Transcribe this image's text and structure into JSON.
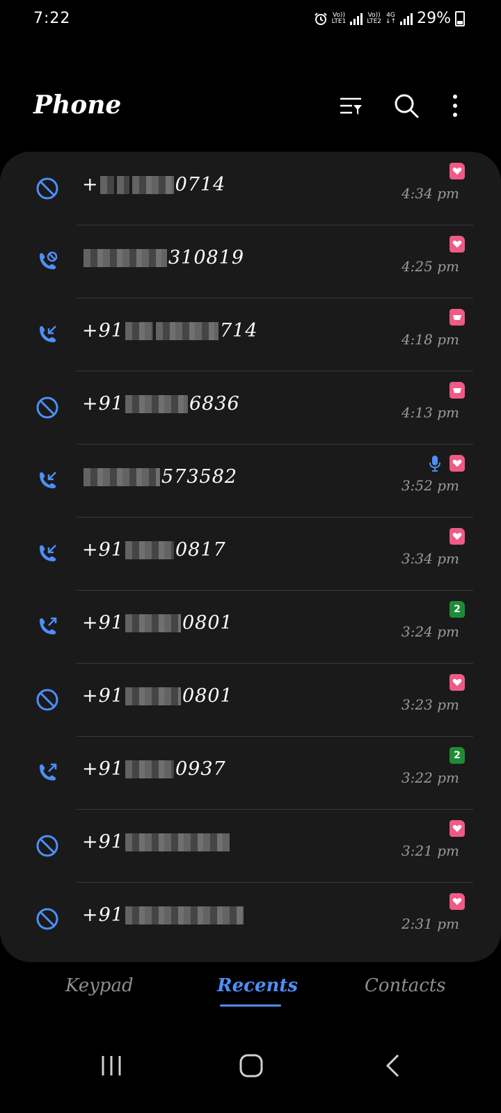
{
  "status_bar": {
    "time": "7:22",
    "sim1_label": "VoLTE1",
    "sim2_label": "VoLTE2",
    "network": "4G",
    "battery": "29%"
  },
  "header": {
    "title": "Phone",
    "icons": [
      "filter-icon",
      "search-icon",
      "more-options-icon"
    ]
  },
  "colors": {
    "accent": "#4d8ff7",
    "sim_pink": "#ef5a86",
    "sim_green": "#1e8c35",
    "card_bg": "#1a1a1b"
  },
  "calls": [
    {
      "type": "blocked",
      "number_prefix": "+",
      "number_suffix": "0714",
      "sim": "sim1-heart",
      "time": "4:34 pm",
      "mic": false
    },
    {
      "type": "missed-blocked",
      "number_prefix": "",
      "number_suffix": "310819",
      "sim": "sim1-heart",
      "time": "4:25 pm",
      "mic": false
    },
    {
      "type": "incoming",
      "number_prefix": "+91",
      "number_suffix": "714",
      "sim": "sim1-card",
      "time": "4:18 pm",
      "mic": false
    },
    {
      "type": "blocked",
      "number_prefix": "+91",
      "number_suffix": "6836",
      "sim": "sim1-card",
      "time": "4:13 pm",
      "mic": false
    },
    {
      "type": "incoming",
      "number_prefix": "",
      "number_suffix": "573582",
      "sim": "sim1-heart",
      "time": "3:52 pm",
      "mic": true
    },
    {
      "type": "incoming",
      "number_prefix": "+91",
      "number_suffix": "0817",
      "sim": "sim1-heart",
      "time": "3:34 pm",
      "mic": false
    },
    {
      "type": "outgoing",
      "number_prefix": "+91",
      "number_suffix": "0801",
      "sim": "sim2",
      "sim_label": "2",
      "time": "3:24 pm",
      "mic": false
    },
    {
      "type": "blocked",
      "number_prefix": "+91",
      "number_suffix": "0801",
      "sim": "sim1-heart",
      "time": "3:23 pm",
      "mic": false
    },
    {
      "type": "outgoing",
      "number_prefix": "+91",
      "number_suffix": "0937",
      "sim": "sim2",
      "sim_label": "2",
      "time": "3:22 pm",
      "mic": false
    },
    {
      "type": "blocked",
      "number_prefix": "+91",
      "number_suffix": "",
      "sim": "sim1-heart",
      "time": "3:21 pm",
      "mic": false
    },
    {
      "type": "blocked",
      "number_prefix": "+91",
      "number_suffix": "",
      "sim": "sim1-heart",
      "time": "2:31 pm",
      "mic": false
    }
  ],
  "tabs": {
    "keypad": "Keypad",
    "recents": "Recents",
    "contacts": "Contacts",
    "active": "recents"
  }
}
